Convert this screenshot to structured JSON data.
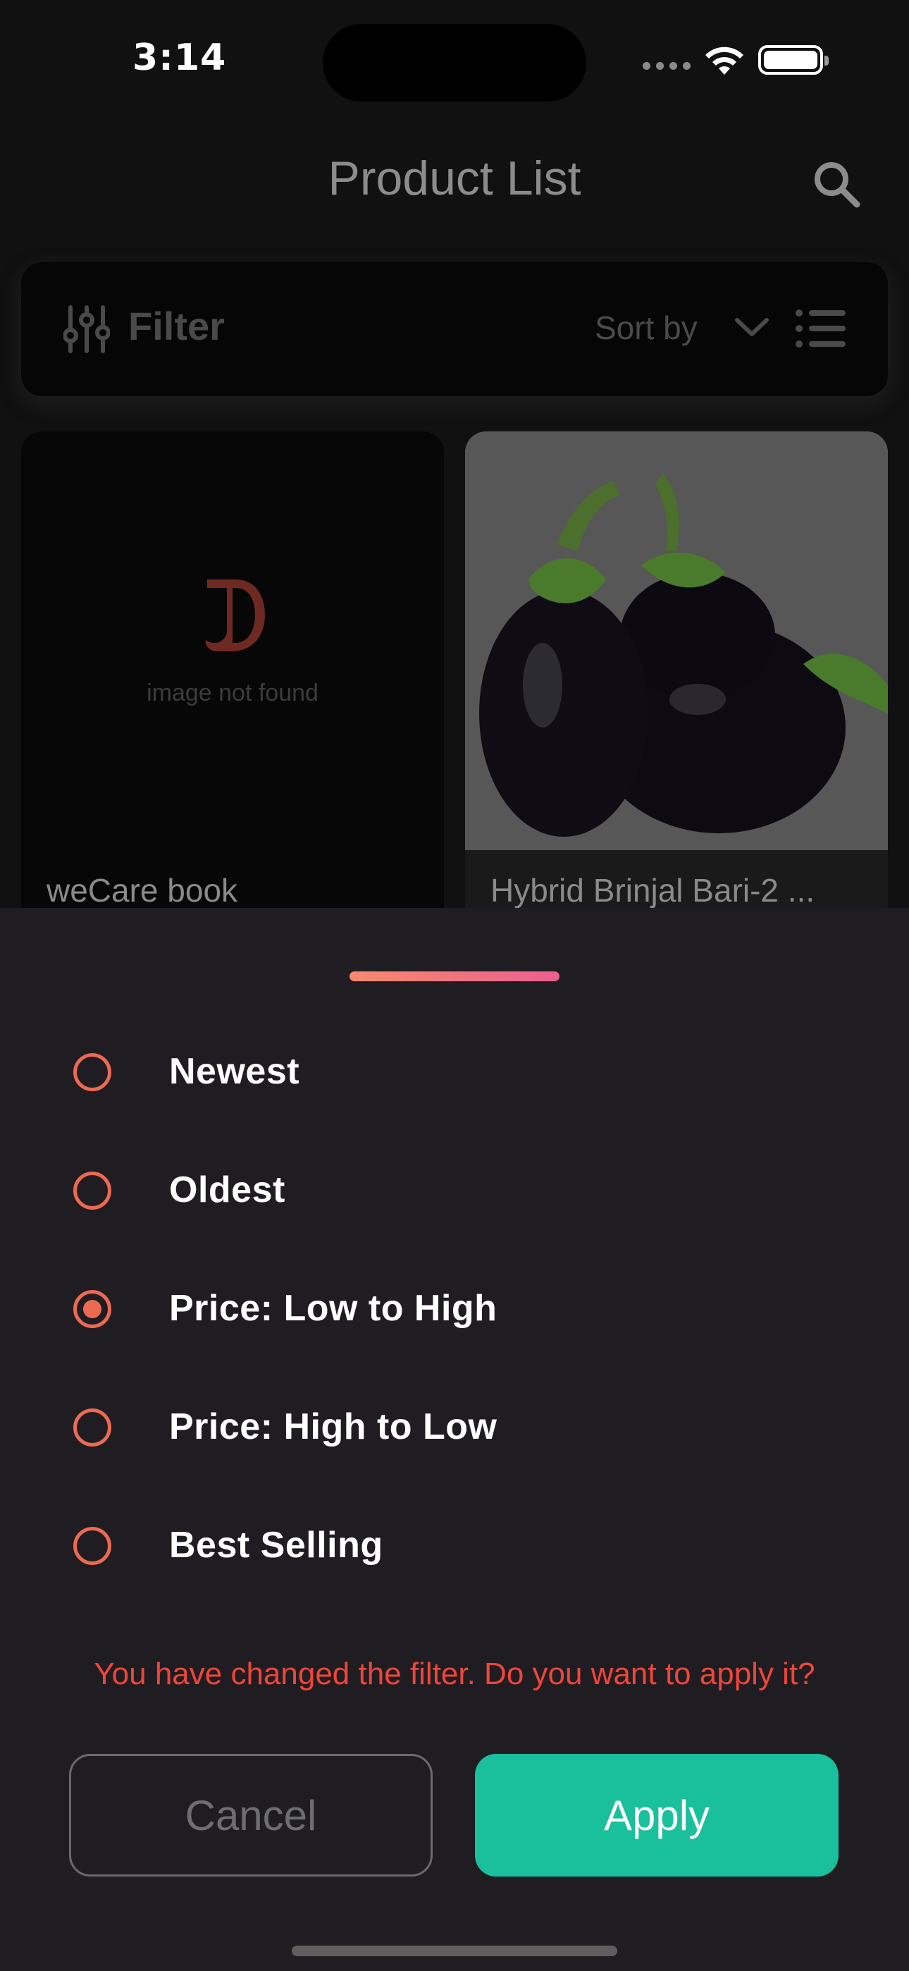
{
  "status_bar": {
    "time": "3:14",
    "icons": [
      "signal-dots-icon",
      "wifi-icon",
      "battery-icon"
    ]
  },
  "nav": {
    "title": "Product List",
    "search_icon": "search-icon"
  },
  "filter_bar": {
    "filter_label": "Filter",
    "sort_label": "Sort by",
    "icons": [
      "filter-sliders-icon",
      "chevron-down-icon",
      "list-view-icon"
    ]
  },
  "products": [
    {
      "title": "weCare book",
      "placeholder_text": "image not found"
    },
    {
      "title": "Hybrid Brinjal Bari-2 ..."
    }
  ],
  "sort_sheet": {
    "options": [
      {
        "label": "Newest",
        "selected": false
      },
      {
        "label": "Oldest",
        "selected": false
      },
      {
        "label": "Price: Low to High",
        "selected": true
      },
      {
        "label": "Price: High to Low",
        "selected": false
      },
      {
        "label": "Best Selling",
        "selected": false
      }
    ],
    "confirm_message": "You have changed the filter. Do you want to apply it?",
    "cancel_label": "Cancel",
    "apply_label": "Apply"
  },
  "colors": {
    "accent": "#ec6a52",
    "apply_button": "#1abf9b",
    "warning_text": "#f0453a",
    "sheet_background": "#1f1d21"
  }
}
